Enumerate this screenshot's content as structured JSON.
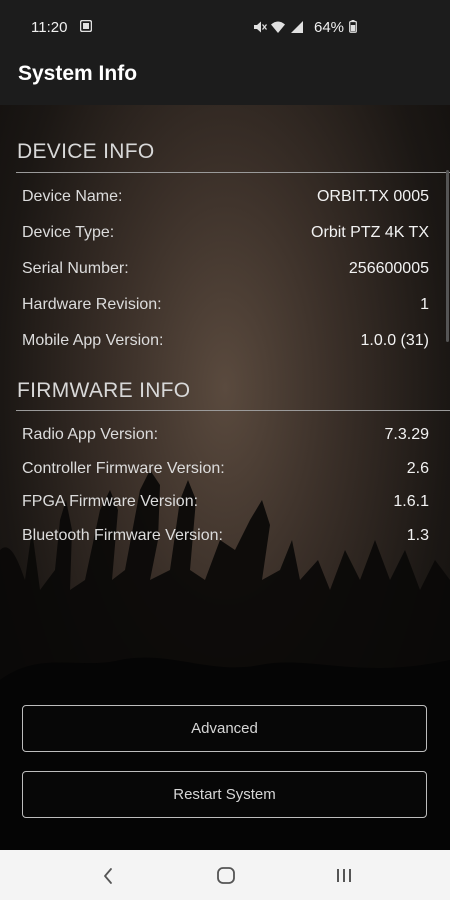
{
  "status_bar": {
    "time": "11:20",
    "battery": "64%"
  },
  "app_bar": {
    "title": "System Info"
  },
  "device_info": {
    "header": "DEVICE INFO",
    "rows": [
      {
        "label": "Device Name:",
        "value": "ORBIT.TX 0005"
      },
      {
        "label": "Device Type:",
        "value": "Orbit PTZ 4K TX"
      },
      {
        "label": "Serial Number:",
        "value": "256600005"
      },
      {
        "label": "Hardware Revision:",
        "value": "1"
      },
      {
        "label": "Mobile App Version:",
        "value": "1.0.0 (31)"
      }
    ]
  },
  "firmware_info": {
    "header": "FIRMWARE INFO",
    "rows": [
      {
        "label": "Radio App Version:",
        "value": "7.3.29"
      },
      {
        "label": "Controller Firmware Version:",
        "value": "2.6"
      },
      {
        "label": "FPGA Firmware Version:",
        "value": "1.6.1"
      },
      {
        "label": "Bluetooth Firmware Version:",
        "value": "1.3"
      }
    ]
  },
  "buttons": {
    "advanced": "Advanced",
    "restart": "Restart System"
  },
  "nav_bar": {
    "back_icon": "chevron-left-icon",
    "home_icon": "rounded-square-icon",
    "recents_icon": "three-bars-icon"
  },
  "colors": {
    "background": "#0d0d0d",
    "bar": "#1c1c1c",
    "text": "#e8e8e8",
    "nav_bar": "#f4f4f4"
  }
}
